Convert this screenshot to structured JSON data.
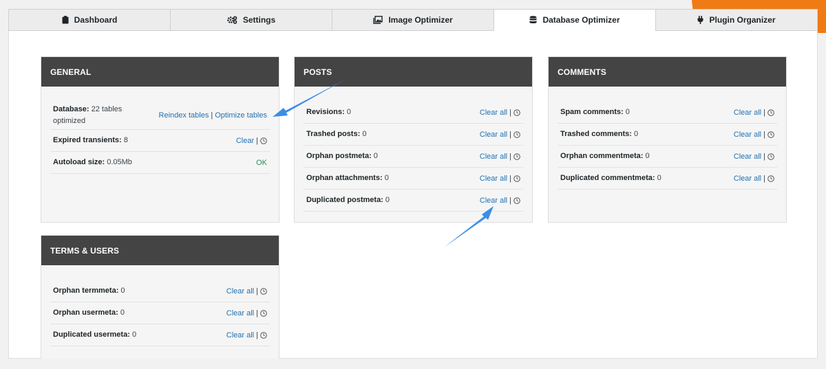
{
  "colors": {
    "accent": "#f07a14",
    "header": "#444444",
    "link": "#2271b1",
    "ok": "#2e8b57",
    "arrow": "#3a8ee6"
  },
  "tabs": [
    {
      "label": "Dashboard",
      "icon": "clipboard-icon"
    },
    {
      "label": "Settings",
      "icon": "gears-icon"
    },
    {
      "label": "Image Optimizer",
      "icon": "images-icon"
    },
    {
      "label": "Database Optimizer",
      "icon": "database-icon",
      "active": true
    },
    {
      "label": "Plugin Organizer",
      "icon": "plug-icon"
    }
  ],
  "general": {
    "title": "GENERAL",
    "database": {
      "label": "Database:",
      "value": "22 tables optimized",
      "reindex": "Reindex tables",
      "separator": "|",
      "optimize": "Optimize tables"
    },
    "transients": {
      "label": "Expired transients:",
      "value": "8",
      "action": "Clear"
    },
    "autoload": {
      "label": "Autoload size:",
      "value": "0.05Mb",
      "status": "OK"
    }
  },
  "posts": {
    "title": "POSTS",
    "rows": [
      {
        "label": "Revisions:",
        "value": "0",
        "action": "Clear all"
      },
      {
        "label": "Trashed posts:",
        "value": "0",
        "action": "Clear all"
      },
      {
        "label": "Orphan postmeta:",
        "value": "0",
        "action": "Clear all"
      },
      {
        "label": "Orphan attachments:",
        "value": "0",
        "action": "Clear all"
      },
      {
        "label": "Duplicated postmeta:",
        "value": "0",
        "action": "Clear all"
      }
    ]
  },
  "comments": {
    "title": "COMMENTS",
    "rows": [
      {
        "label": "Spam comments:",
        "value": "0",
        "action": "Clear all"
      },
      {
        "label": "Trashed comments:",
        "value": "0",
        "action": "Clear all"
      },
      {
        "label": "Orphan commentmeta:",
        "value": "0",
        "action": "Clear all"
      },
      {
        "label": "Duplicated commentmeta:",
        "value": "0",
        "action": "Clear all"
      }
    ]
  },
  "terms": {
    "title": "TERMS & USERS",
    "rows": [
      {
        "label": "Orphan termmeta:",
        "value": "0",
        "action": "Clear all"
      },
      {
        "label": "Orphan usermeta:",
        "value": "0",
        "action": "Clear all"
      },
      {
        "label": "Duplicated usermeta:",
        "value": "0",
        "action": "Clear all"
      }
    ]
  },
  "separator": "|"
}
